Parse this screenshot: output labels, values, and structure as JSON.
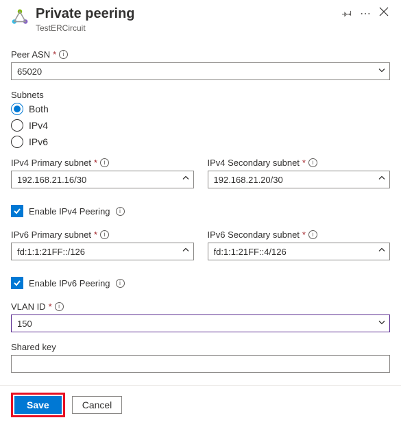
{
  "header": {
    "title": "Private peering",
    "subtitle": "TestERCircuit"
  },
  "fields": {
    "peer_asn": {
      "label": "Peer ASN",
      "value": "65020"
    },
    "subnets": {
      "label": "Subnets",
      "options": {
        "both": "Both",
        "ipv4": "IPv4",
        "ipv6": "IPv6"
      },
      "selected": "both"
    },
    "ipv4_primary": {
      "label": "IPv4 Primary subnet",
      "value": "192.168.21.16/30"
    },
    "ipv4_secondary": {
      "label": "IPv4 Secondary subnet",
      "value": "192.168.21.20/30"
    },
    "enable_ipv4": {
      "label": "Enable IPv4 Peering",
      "checked": true
    },
    "ipv6_primary": {
      "label": "IPv6 Primary subnet",
      "value": "fd:1:1:21FF::/126"
    },
    "ipv6_secondary": {
      "label": "IPv6 Secondary subnet",
      "value": "fd:1:1:21FF::4/126"
    },
    "enable_ipv6": {
      "label": "Enable IPv6 Peering",
      "checked": true
    },
    "vlan_id": {
      "label": "VLAN ID",
      "value": "150"
    },
    "shared_key": {
      "label": "Shared key",
      "value": ""
    }
  },
  "footer": {
    "save": "Save",
    "cancel": "Cancel"
  }
}
